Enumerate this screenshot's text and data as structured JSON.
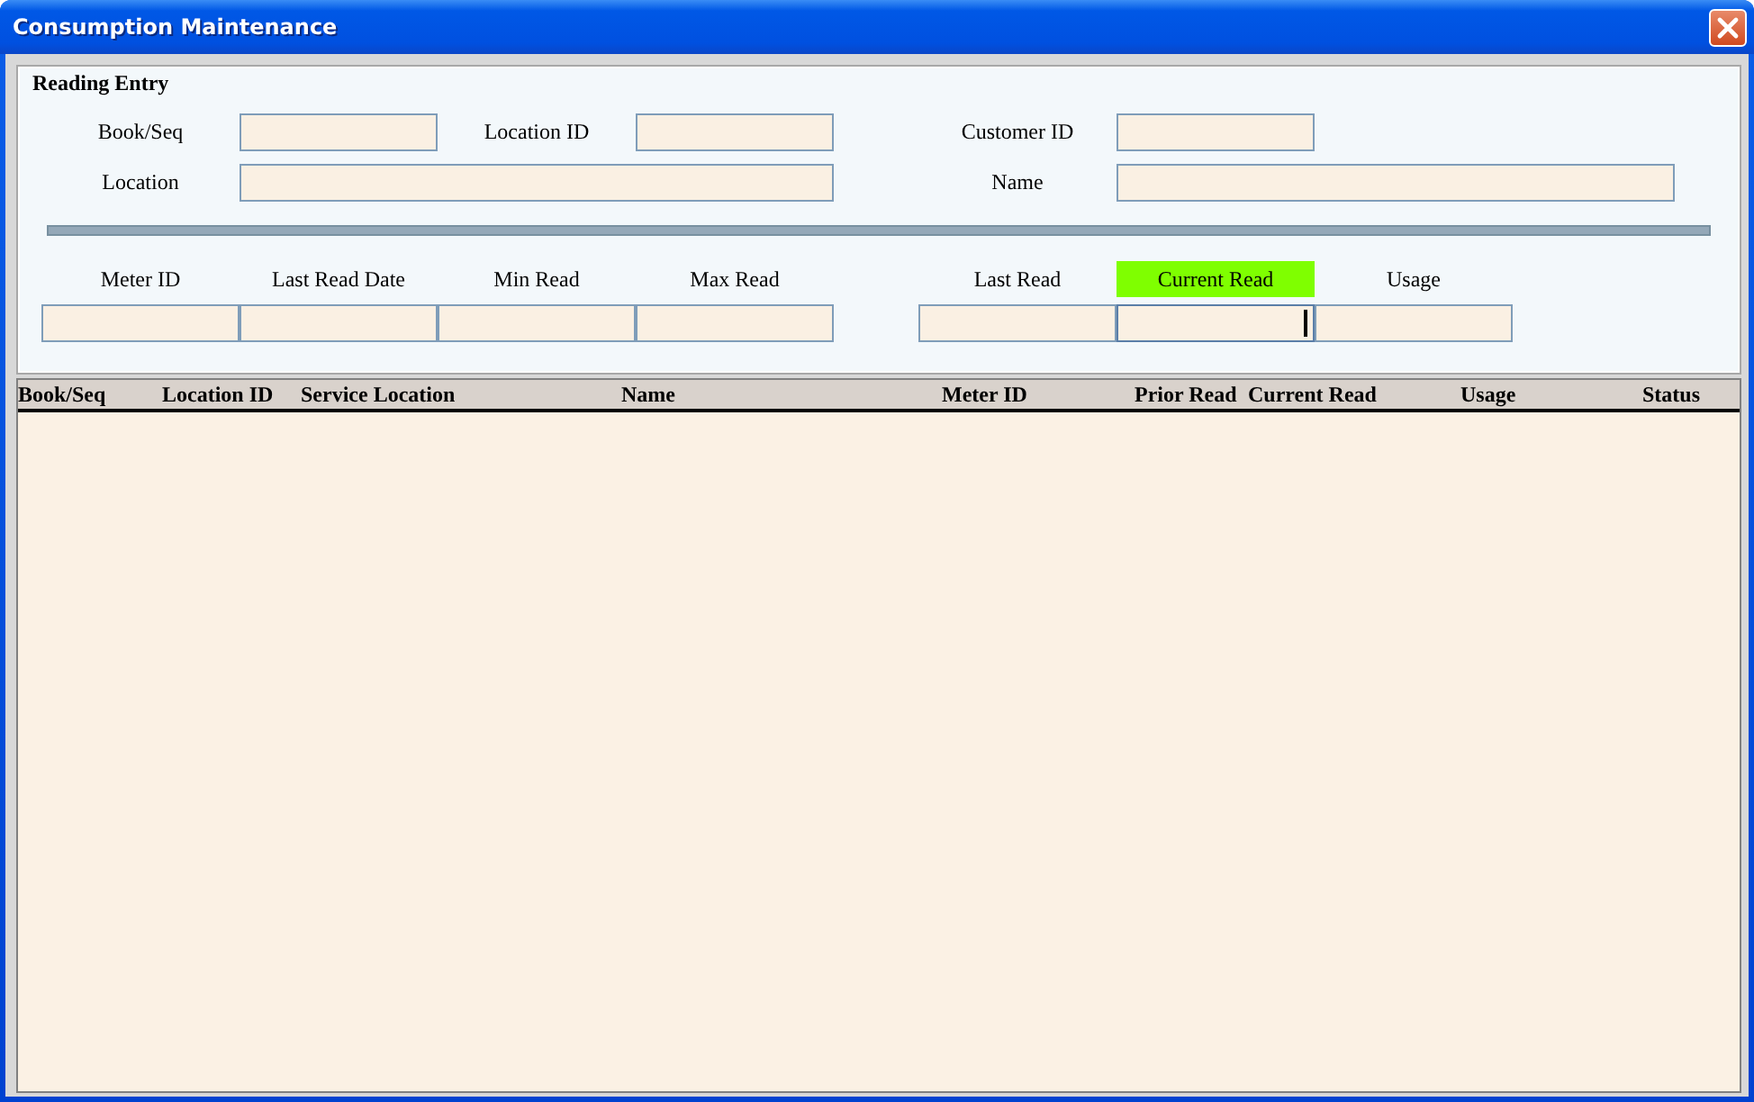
{
  "window": {
    "title": "Consumption Maintenance"
  },
  "reading_entry": {
    "title": "Reading Entry",
    "row_1": [
      {
        "label": "Book/Seq"
      },
      {
        "label": "Location ID"
      },
      {
        "label": "Customer ID"
      }
    ],
    "row_2": [
      {
        "label": "Location"
      },
      {
        "label": "Name"
      }
    ],
    "meter_fields": [
      {
        "label": "Meter ID",
        "highlighted": false,
        "focused": false
      },
      {
        "label": "Last Read Date",
        "highlighted": false,
        "focused": false
      },
      {
        "label": "Min Read",
        "highlighted": false,
        "focused": false
      },
      {
        "label": "Max Read",
        "highlighted": false,
        "focused": false
      }
    ],
    "reading_fields": [
      {
        "label": "Last Read",
        "highlighted": false,
        "focused": false
      },
      {
        "label": "Current Read",
        "highlighted": true,
        "focused": true
      },
      {
        "label": "Usage",
        "highlighted": false,
        "focused": false
      }
    ]
  },
  "table": {
    "columns": [
      "Book/Seq",
      "Location ID",
      "Service Location",
      "Name",
      "Meter ID",
      "Prior Read",
      "Current Read",
      "Usage",
      "Status"
    ]
  }
}
